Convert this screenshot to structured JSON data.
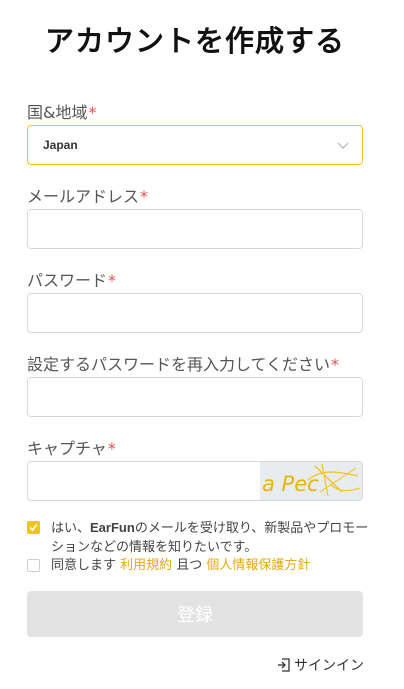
{
  "page": {
    "title": "アカウントを作成する"
  },
  "form": {
    "country": {
      "label": "国&地域",
      "required_mark": "*",
      "value": "Japan"
    },
    "email": {
      "label": "メールアドレス",
      "required_mark": "*",
      "value": ""
    },
    "password": {
      "label": "パスワード",
      "required_mark": "*",
      "value": ""
    },
    "password_confirm": {
      "label": "設定するパスワードを再入力してください",
      "required_mark": "*",
      "value": ""
    },
    "captcha": {
      "label": "キャプチャ",
      "required_mark": "*",
      "value": "",
      "image_text": "a Pec"
    }
  },
  "consent": {
    "newsletter": {
      "checked": true,
      "text_before": "はい、",
      "brand": "EarFun",
      "text_after": "のメールを受け取り、新製品やプロモーションなどの情報を知りたいです。"
    },
    "terms": {
      "checked": false,
      "text_before": "同意します ",
      "terms_link": "利用規約",
      "conjunction": " 且つ ",
      "privacy_link": "個人情報保護方針"
    }
  },
  "actions": {
    "submit_label": "登録",
    "signin_label": "サインイン"
  },
  "colors": {
    "accent": "#f0c419",
    "required": "#e0524f",
    "link": "#e2a90e",
    "button_disabled": "#e3e3e3"
  }
}
